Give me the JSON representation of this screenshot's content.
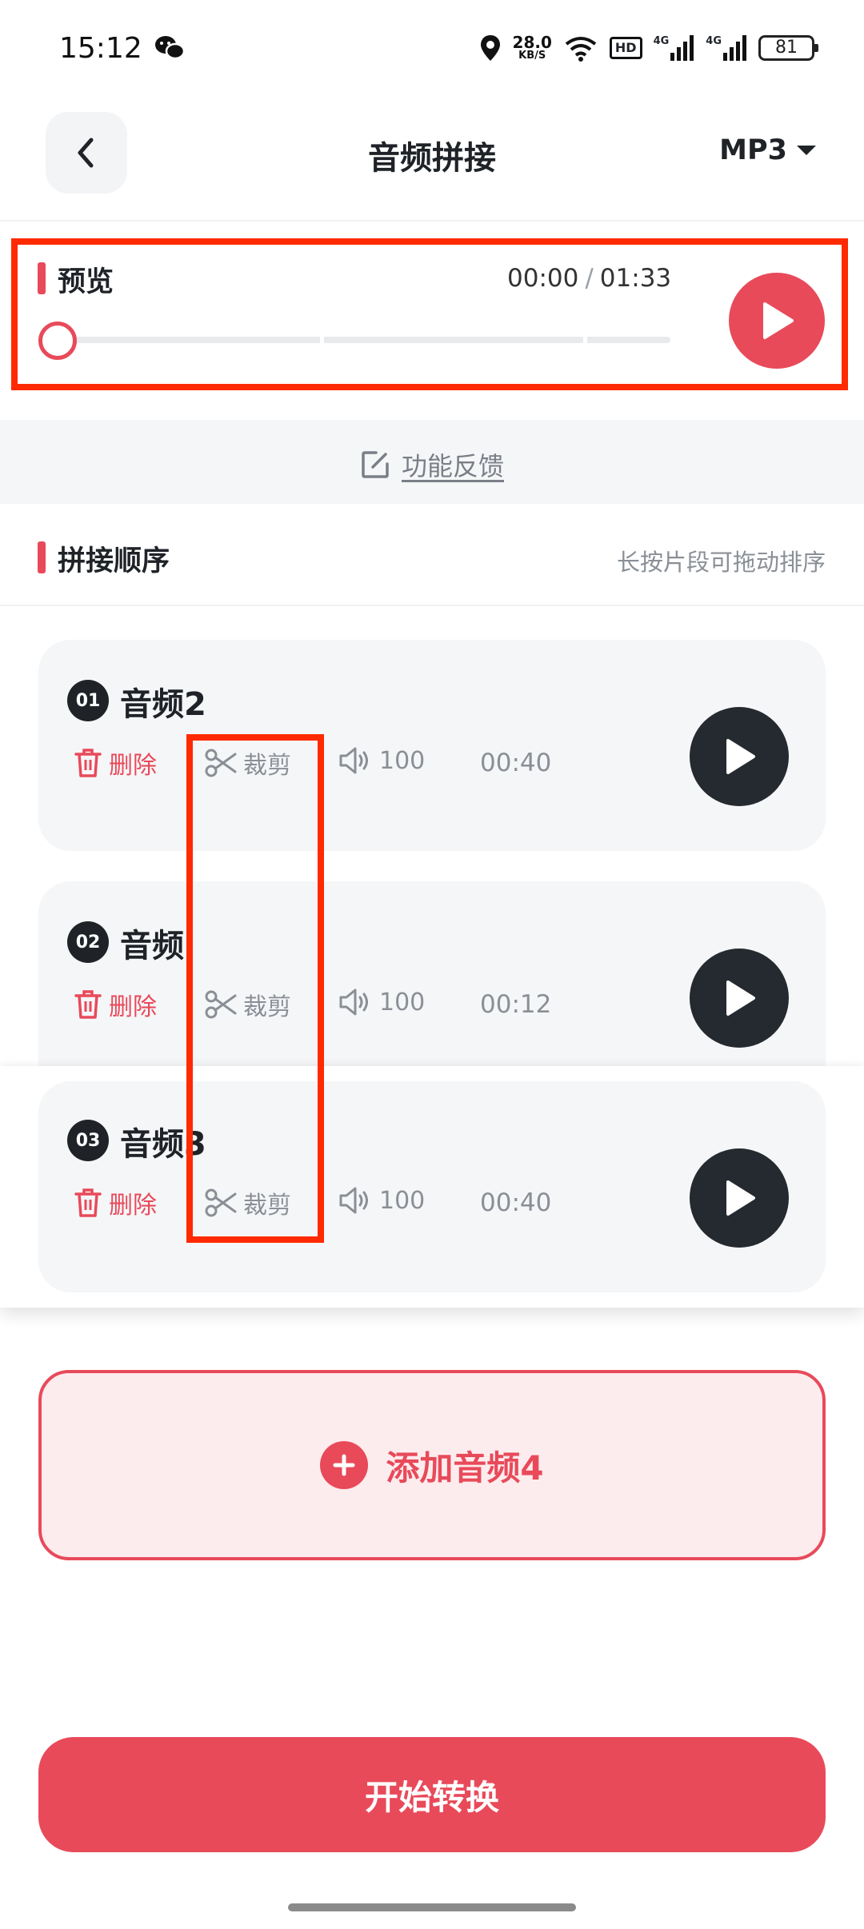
{
  "status_bar": {
    "time": "15:12",
    "net_speed_value": "28.0",
    "net_speed_unit": "KB/S",
    "hd_badge": "HD",
    "signal_1": "4G",
    "signal_2": "4G",
    "battery": "81"
  },
  "header": {
    "title": "音频拼接",
    "format": "MP3"
  },
  "preview": {
    "label": "预览",
    "current_time": "00:00",
    "separator": "/",
    "total_time": "01:33",
    "progress": 0
  },
  "feedback": {
    "label": "功能反馈"
  },
  "order": {
    "label": "拼接顺序",
    "hint": "长按片段可拖动排序"
  },
  "clips": [
    {
      "number": "01",
      "name": "音频2",
      "delete": "删除",
      "trim": "裁剪",
      "volume": "100",
      "duration": "00:40"
    },
    {
      "number": "02",
      "name": "音频",
      "delete": "删除",
      "trim": "裁剪",
      "volume": "100",
      "duration": "00:12"
    },
    {
      "number": "03",
      "name": "音频3",
      "delete": "删除",
      "trim": "裁剪",
      "volume": "100",
      "duration": "00:40"
    }
  ],
  "add_button": {
    "label": "添加音频4"
  },
  "start_button": {
    "label": "开始转换"
  },
  "colors": {
    "accent": "#e84a5a",
    "highlight_frame": "#ff2a00",
    "dark_button": "#252a30"
  }
}
